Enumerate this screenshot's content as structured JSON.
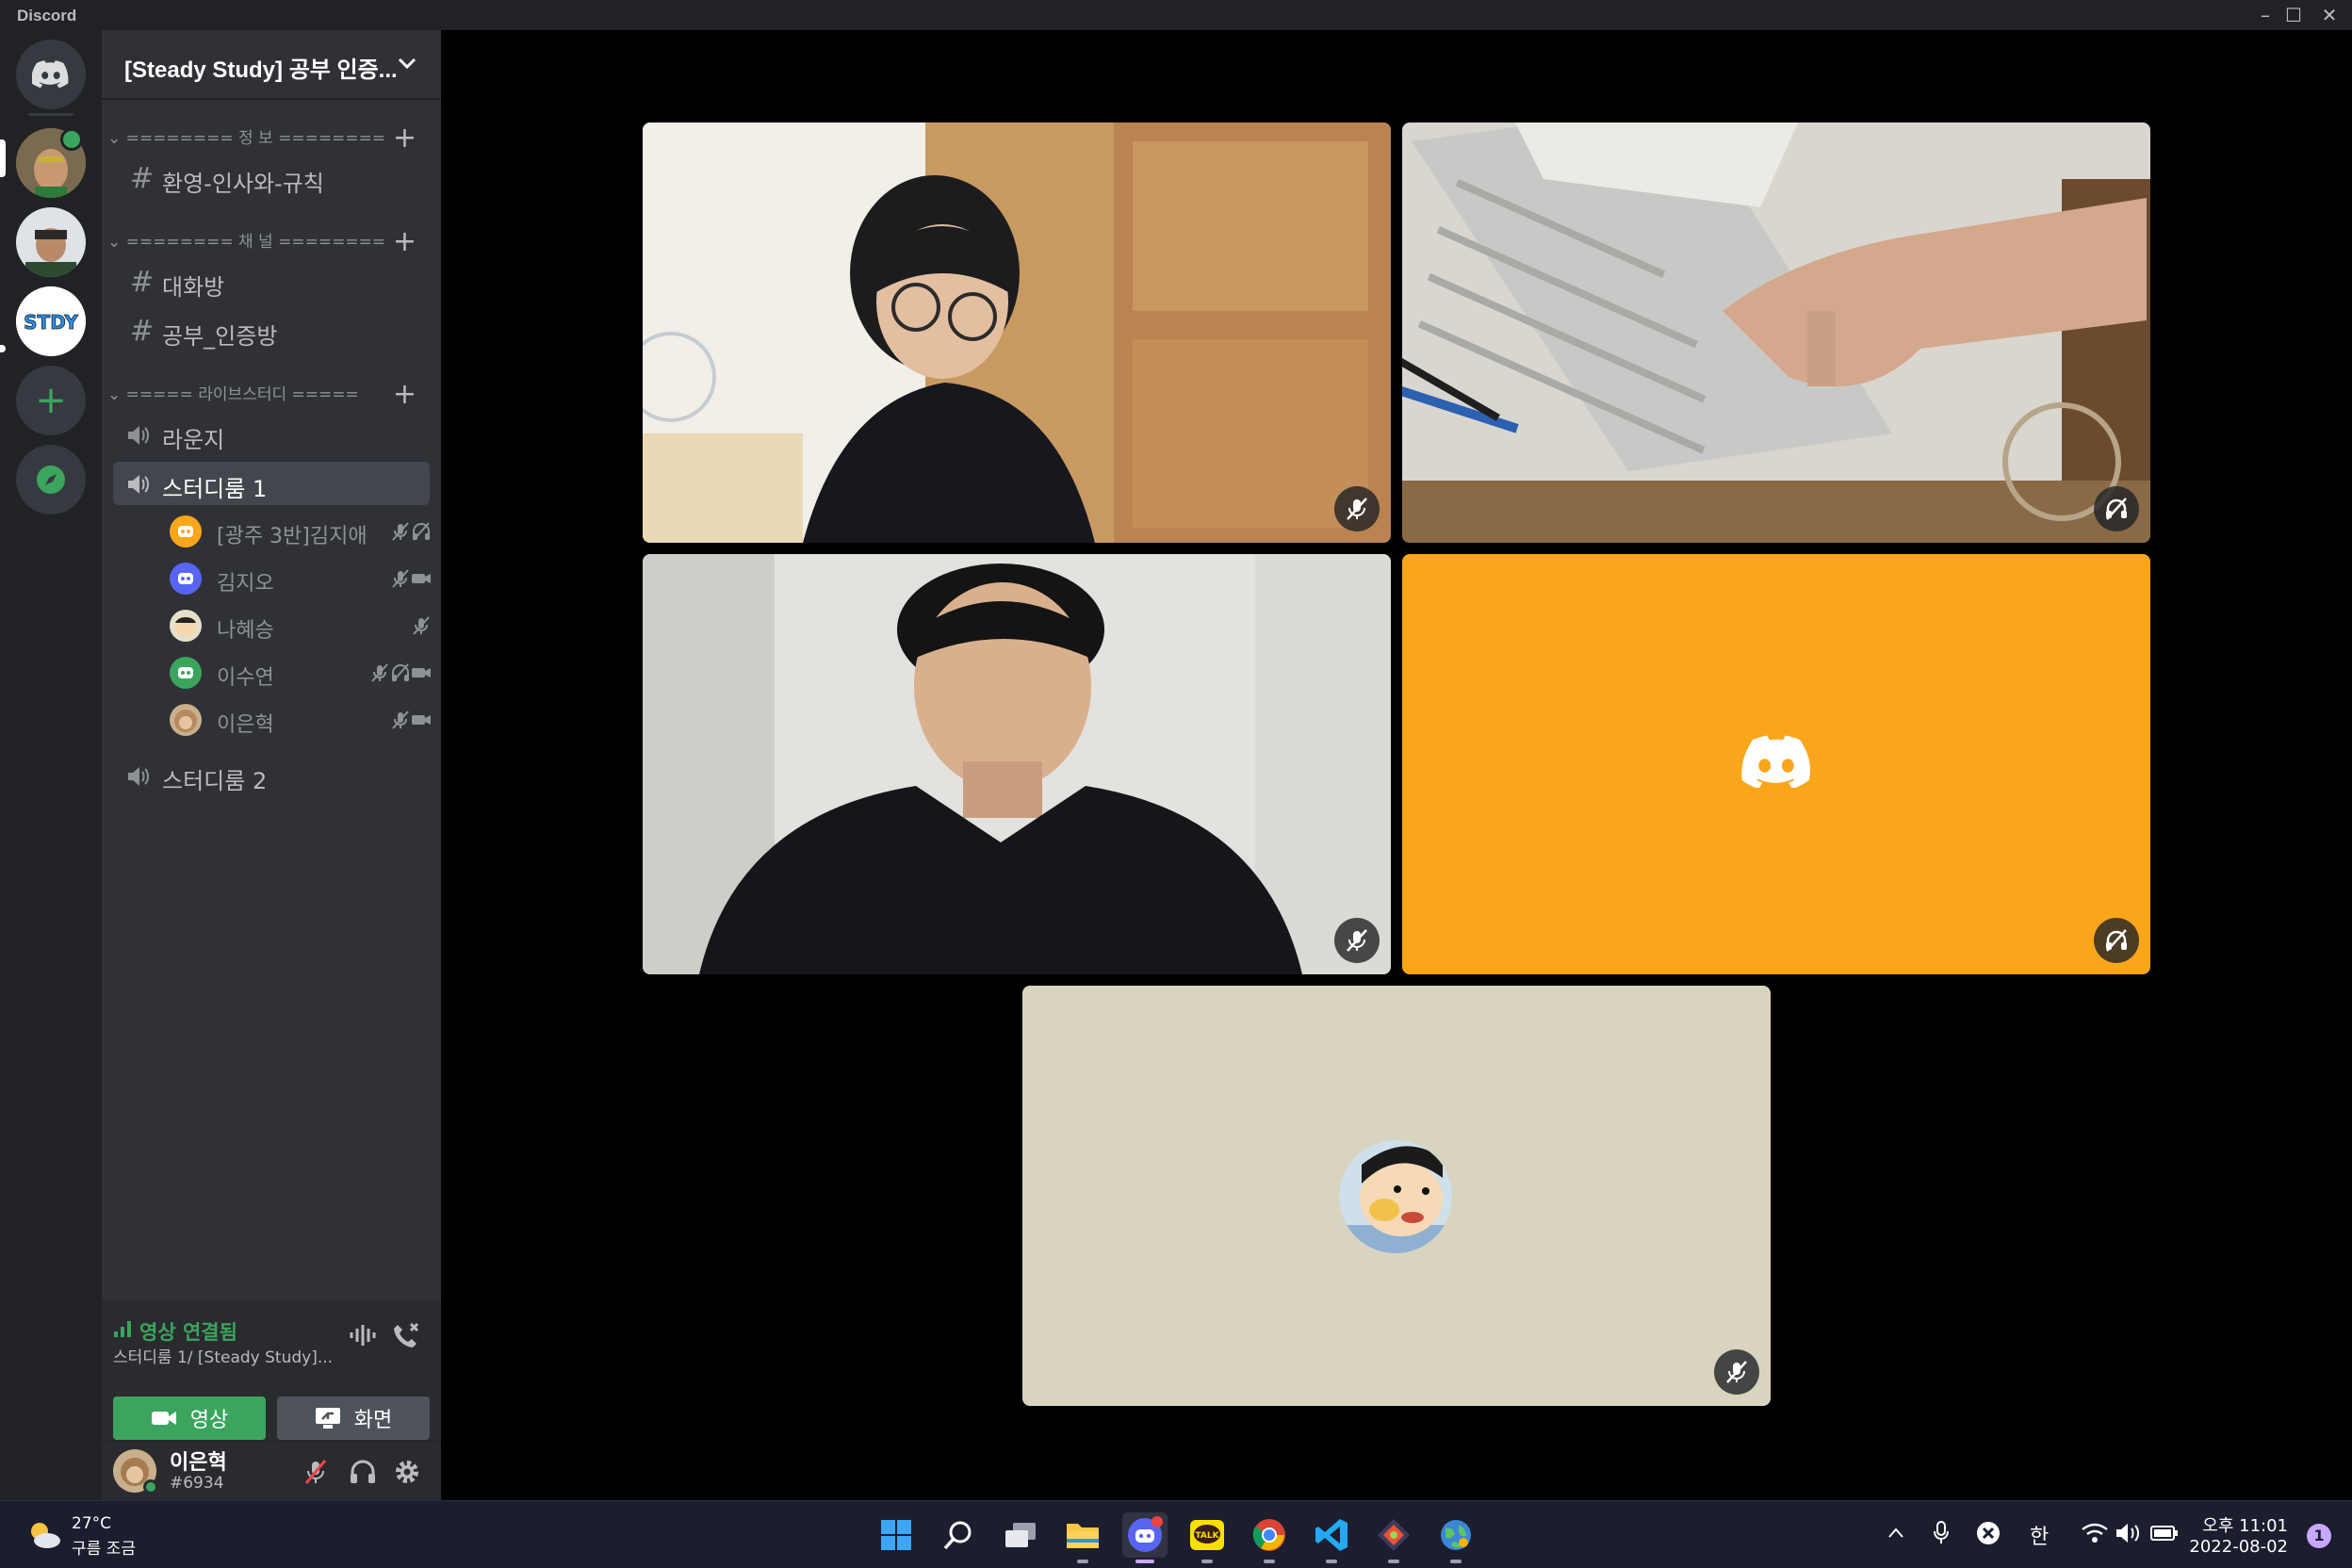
{
  "window": {
    "app_name": "Discord"
  },
  "guild": {
    "name": "[Steady Study] 공부 인증..."
  },
  "categories": [
    {
      "label": "======== 정 보 ========",
      "channels": [
        {
          "name": "환영-인사와-규칙"
        }
      ]
    },
    {
      "label": "======== 채 널 ========",
      "channels": [
        {
          "name": "대화방"
        },
        {
          "name": "공부_인증방"
        }
      ]
    },
    {
      "label": "===== 라이브스터디 =====",
      "channels": [
        {
          "name": "라운지"
        },
        {
          "name": "스터디룸 1"
        },
        {
          "name": "스터디룸 2"
        }
      ]
    }
  ],
  "voice_users": [
    {
      "name": "[광주 3반]김지애"
    },
    {
      "name": "김지오"
    },
    {
      "name": "나혜승"
    },
    {
      "name": "이수연"
    },
    {
      "name": "이은혁"
    }
  ],
  "voice_panel": {
    "status": "영상 연결됨",
    "location": "스터디룸 1/ [Steady Study]...",
    "video_label": "영상",
    "screen_label": "화면"
  },
  "user": {
    "name": "이은혁",
    "tag": "#6934"
  },
  "colors": {
    "accent_green": "#3ba55d",
    "blurple": "#5865f2",
    "tile_orange": "#faa61a",
    "tile_beige": "#d8d4bf"
  },
  "taskbar": {
    "weather_temp": "27°C",
    "weather_desc": "구름 조금",
    "ime": "한",
    "time": "오후 11:01",
    "date": "2022-08-02",
    "notifications": "1"
  }
}
